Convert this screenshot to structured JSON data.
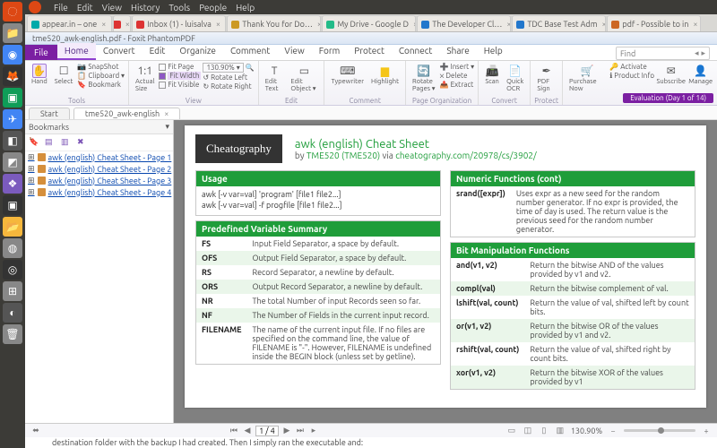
{
  "menubar": {
    "items": [
      "File",
      "Edit",
      "View",
      "History",
      "Tools",
      "People",
      "Help"
    ]
  },
  "browser_tabs": [
    {
      "label": "appear.in – one",
      "fav": "#0aa",
      "close": true
    },
    {
      "label": "",
      "fav": "#d33",
      "short": true
    },
    {
      "label": "Inbox (1) - luisalva",
      "fav": "#d33"
    },
    {
      "label": "Thank You for Do…",
      "fav": "#c92"
    },
    {
      "label": "My Drive - Google D",
      "fav": "#2b8"
    },
    {
      "label": "The Developer Cl…",
      "fav": "#27c"
    },
    {
      "label": "TDC Base Test Adm",
      "fav": "#27c"
    },
    {
      "label": "pdf - Possible to in",
      "fav": "#c62"
    }
  ],
  "window_title": "tme520_awk-english.pdf - Foxit PhantomPDF",
  "ribbon": {
    "file": "File",
    "tabs": [
      "Home",
      "Convert",
      "Edit",
      "Organize",
      "Comment",
      "View",
      "Form",
      "Protect",
      "Connect",
      "Share",
      "Help"
    ],
    "active": "Home",
    "find_placeholder": "Find",
    "groups": {
      "tools": "Tools",
      "view": "View",
      "edit": "Edit",
      "comment": "Comment",
      "pageorg": "Page Organization",
      "convert": "Convert",
      "protect": "Protect"
    },
    "btn": {
      "hand": "Hand",
      "select": "Select",
      "snapshot": "SnapShot",
      "clipboard": "Clipboard ▾",
      "bookmark": "Bookmark",
      "actual": "Actual Size",
      "fitpage": "Fit Page",
      "fitwidth": "Fit Width",
      "fitvisible": "Fit Visible",
      "zoom": "130.90%",
      "rotl": "Rotate Left",
      "rotr": "Rotate Right",
      "edittext": "Edit Text",
      "editobj": "Edit Object ▾",
      "typewriter": "Typewriter",
      "highlight": "Highlight",
      "rotatepg": "Rotate Pages ▾",
      "insert": "Insert ▾",
      "delete": "Delete",
      "extract": "Extract",
      "scan": "Scan",
      "quickocr": "Quick OCR",
      "pdfsign": "PDF Sign",
      "purchase": "Purchase Now",
      "activate": "Activate",
      "prodinfo": "Product Info",
      "subscribe": "Subscribe",
      "manage": "Manage"
    },
    "eval": "Evaluation (Day 1 of 14)"
  },
  "doctabs": {
    "start": "Start",
    "doc": "tme520_awk-english"
  },
  "sidebar": {
    "title": "Bookmarks",
    "items": [
      "awk (english) Cheat Sheet - Page 1",
      "awk (english) Cheat Sheet - Page 2",
      "awk (english) Cheat Sheet - Page 3",
      "awk (english) Cheat Sheet - Page 4"
    ]
  },
  "doc": {
    "logo": "Cheatography",
    "title": "awk (english) Cheat Sheet",
    "byline_pre": "by ",
    "author": "TME520 (TME520)",
    "byline_mid": " via ",
    "url": "cheatography.com/20978/cs/3902/",
    "usage": {
      "h": "Usage",
      "lines": [
        "awk [-v var=val] 'program' [file1 file2...]",
        "awk [-v var=val] -f progfile [file1 file2...]"
      ]
    },
    "predef": {
      "h": "Predefined Variable Summary",
      "rows": [
        [
          "FS",
          "Input Field Separator, a space by default."
        ],
        [
          "OFS",
          "Output Field Separator, a space by default."
        ],
        [
          "RS",
          "Record Separator, a newline by default."
        ],
        [
          "ORS",
          "Output Record Separator, a newline by default."
        ],
        [
          "NR",
          "The total Number of input Records seen so far."
        ],
        [
          "NF",
          "The Number of Fields in the current input record."
        ],
        [
          "FILENAME",
          "The name of the current input file. If no files are specified on the command line, the value of FILENAME is \"-\". However, FILENAME is undefined inside the BEGIN block (unless set by getline)."
        ]
      ]
    },
    "numfn": {
      "h": "Numeric Functions (cont)",
      "rows": [
        [
          "srand([expr])",
          "Uses expr as a new seed for the random number generator. If no expr is provided, the time of day is used. The return value is the previous seed for the random number generator."
        ]
      ]
    },
    "bitfn": {
      "h": "Bit Manipulation Functions",
      "rows": [
        [
          "and(v1, v2)",
          "Return the bitwise AND of the values provided by v1 and v2."
        ],
        [
          "compl(val)",
          "Return the bitwise complement of val."
        ],
        [
          "lshift(val, count)",
          "Return the value of val, shifted left by count bits."
        ],
        [
          "or(v1, v2)",
          "Return the bitwise OR of the values provided by v1 and v2."
        ],
        [
          "rshift(val, count)",
          "Return the value of val, shifted right by count bits."
        ],
        [
          "xor(v1, v2)",
          "Return the bitwise XOR of the values provided by v1"
        ]
      ]
    }
  },
  "status": {
    "page": "1 / 4",
    "zoom": "130.90%"
  },
  "bottom_text": "destination folder with the backup I had created. Then I simply ran the executable and:"
}
